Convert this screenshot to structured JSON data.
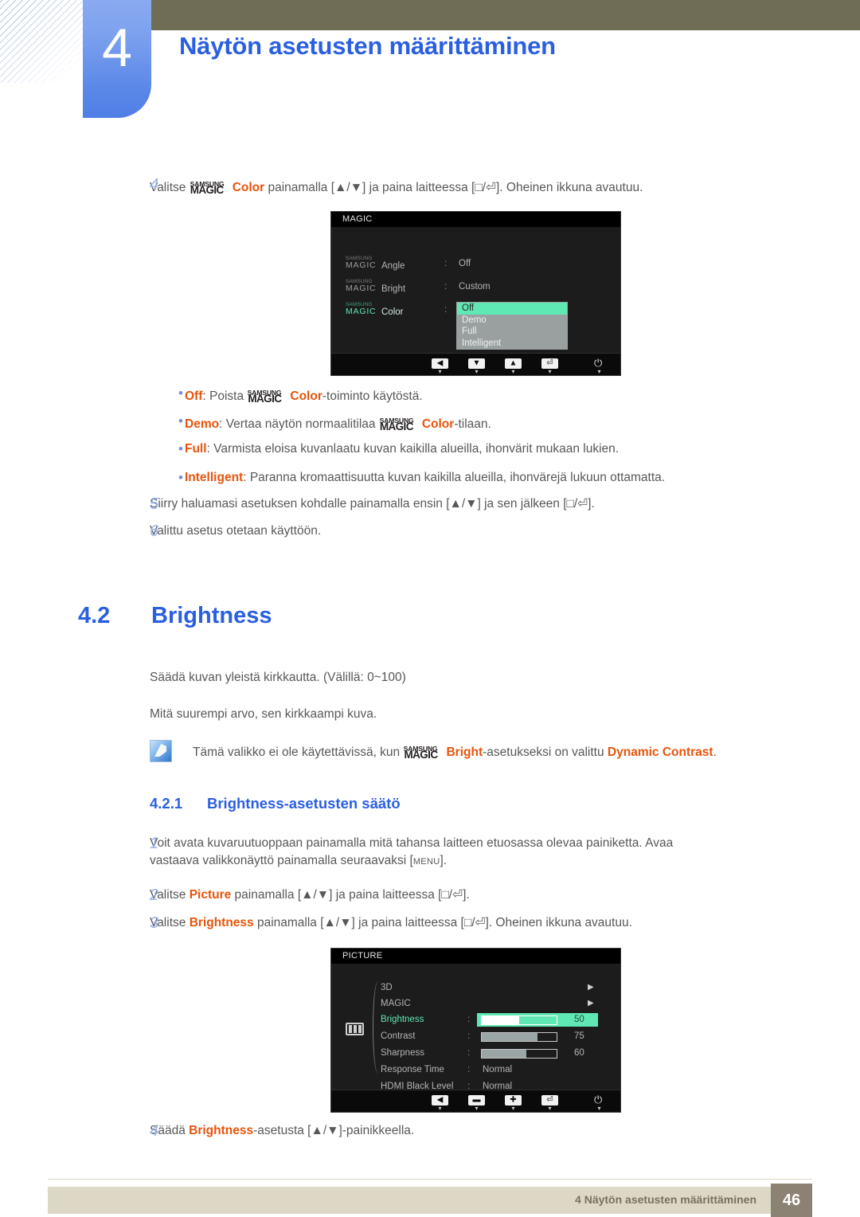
{
  "header": {
    "chapter_number": "4",
    "chapter_title": "Näytön asetusten määrittäminen"
  },
  "steps_top": [
    {
      "num": "4",
      "pre": "Valitse ",
      "magic": "SAMSUNG MAGIC",
      "hl": "Color",
      "post": " painamalla [▲/▼] ja paina laitteessa [□/⏎]. Oheinen ikkuna avautuu."
    }
  ],
  "osd_magic": {
    "title": "MAGIC",
    "magic_small": "SAMSUNG",
    "magic_big": "MAGIC",
    "rows": [
      {
        "label": "Angle",
        "colon": ":",
        "value": "Off"
      },
      {
        "label": "Bright",
        "colon": ":",
        "value": "Custom"
      },
      {
        "label": "Color",
        "colon": ":",
        "value": ""
      }
    ],
    "dropdown": [
      "Off",
      "Demo",
      "Full",
      "Intelligent"
    ],
    "dropdown_selected": "Off",
    "buttons": [
      "◀",
      "▼",
      "▲",
      "⏎"
    ],
    "power_icon": "⏻",
    "accent": "#5fe8b4"
  },
  "bullets": [
    {
      "term": "Off",
      "pre": ": Poista ",
      "magic": true,
      "hl": "Color",
      "post": "-toiminto käytöstä."
    },
    {
      "term": "Demo",
      "pre": ": Vertaa näytön normaalitilaa ",
      "magic": true,
      "hl": "Color",
      "post": "-tilaan."
    },
    {
      "term": "Full",
      "pre": ": Varmista eloisa kuvanlaatu kuvan kaikilla alueilla, ihonvärit mukaan lukien.",
      "magic": false,
      "hl": "",
      "post": ""
    },
    {
      "term": "Intelligent",
      "pre": ": Paranna kromaattisuutta kuvan kaikilla alueilla, ihonvärejä lukuun ottamatta.",
      "magic": false,
      "hl": "",
      "post": ""
    }
  ],
  "steps_mid": [
    {
      "num": "5",
      "text": "Siirry haluamasi asetuksen kohdalle painamalla ensin [▲/▼] ja sen jälkeen [□/⏎]."
    },
    {
      "num": "6",
      "text": "Valittu asetus otetaan käyttöön."
    }
  ],
  "section": {
    "number": "4.2",
    "title": "Brightness",
    "para1": "Säädä kuvan yleistä kirkkautta. (Välillä: 0~100)",
    "para2": "Mitä suurempi arvo, sen kirkkaampi kuva."
  },
  "note": {
    "pre": "Tämä valikko ei ole käytettävissä, kun ",
    "hl1": "Bright",
    "mid": "-asetukseksi on valittu ",
    "hl2": "Dynamic Contrast",
    "post": "."
  },
  "subsection": {
    "number": "4.2.1",
    "title": "Brightness-asetusten säätö"
  },
  "steps_bottom": [
    {
      "num": "1",
      "line1": "Voit avata kuvaruutuoppaan painamalla mitä tahansa laitteen etuosassa olevaa painiketta. Avaa",
      "line2_pre": "vastaava valikkonäyttö painamalla seuraavaksi [",
      "line2_key": "MENU",
      "line2_post": "]."
    },
    {
      "num": "2",
      "pre": "Valitse ",
      "hl": "Picture",
      "post": " painamalla [▲/▼] ja paina laitteessa [□/⏎]."
    },
    {
      "num": "3",
      "pre": "Valitse ",
      "hl": "Brightness",
      "post": " painamalla [▲/▼] ja paina laitteessa [□/⏎]. Oheinen ikkuna avautuu."
    }
  ],
  "osd_picture": {
    "title": "PICTURE",
    "rows": [
      {
        "label": "3D",
        "type": "submenu",
        "colon": "",
        "value": "",
        "arrow": "▶"
      },
      {
        "label": "MAGIC",
        "type": "submenu",
        "colon": "",
        "value": "",
        "arrow": "▶"
      },
      {
        "label": "Brightness",
        "type": "slider",
        "colon": ":",
        "value": "50",
        "percent": 50,
        "selected": true
      },
      {
        "label": "Contrast",
        "type": "slider",
        "colon": ":",
        "value": "75",
        "percent": 75,
        "selected": false
      },
      {
        "label": "Sharpness",
        "type": "slider",
        "colon": ":",
        "value": "60",
        "percent": 60,
        "selected": false
      },
      {
        "label": "Response Time",
        "type": "text",
        "colon": ":",
        "value": "Normal"
      },
      {
        "label": "HDMI Black Level",
        "type": "text",
        "colon": ":",
        "value": "Normal"
      }
    ],
    "buttons": [
      "◀",
      "▬",
      "✚",
      "⏎"
    ],
    "power_icon": "⏻",
    "accent": "#5fe8b4"
  },
  "steps_end": [
    {
      "num": "4",
      "pre": "Säädä ",
      "hl": "Brightness",
      "post": "-asetusta [▲/▼]-painikkeella."
    }
  ],
  "footer": {
    "text": "4 Näytön asetusten määrittäminen",
    "page": "46"
  }
}
